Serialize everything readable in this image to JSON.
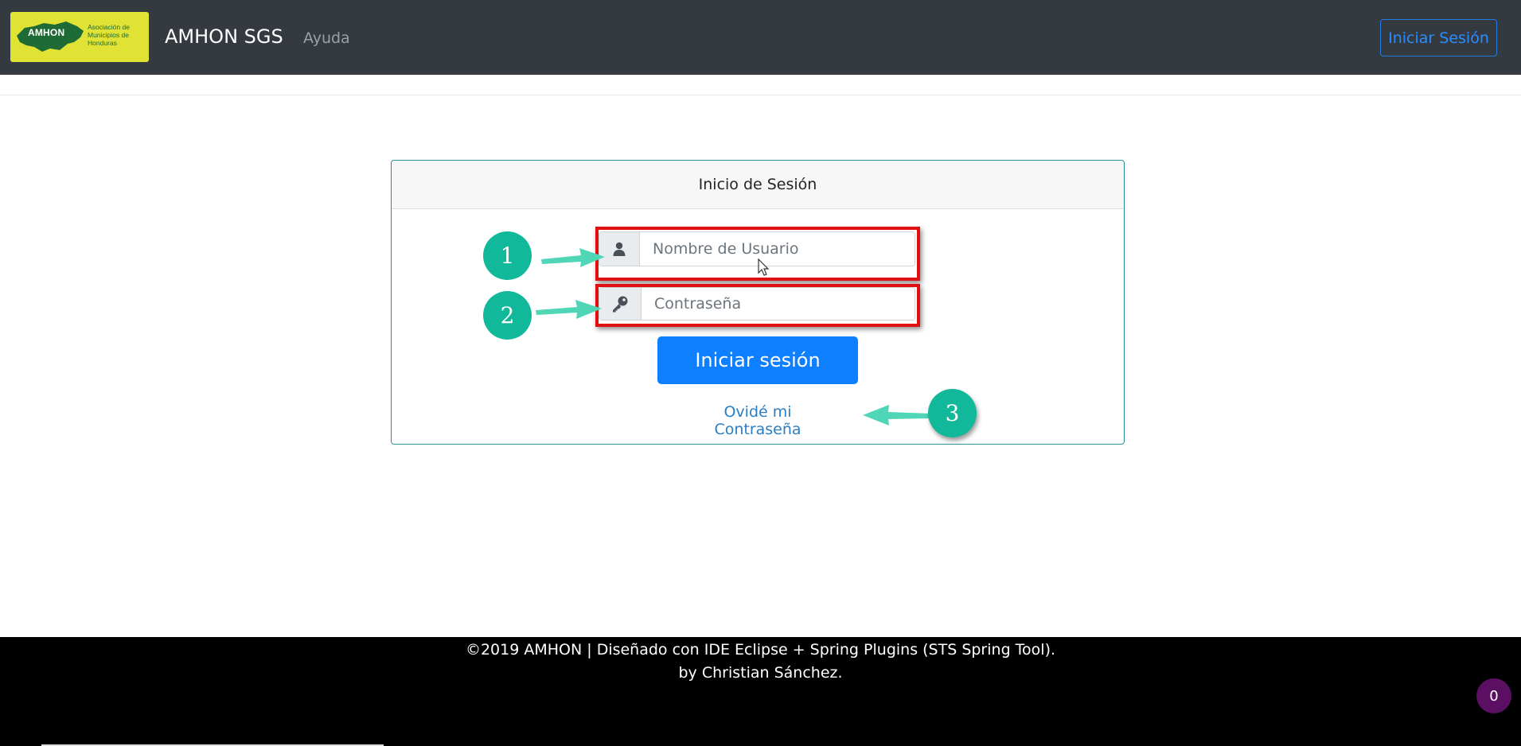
{
  "logo": {
    "mark": "AMHON",
    "sub": "Asociación de Municipios de Honduras"
  },
  "navbar": {
    "brand": "AMHON SGS",
    "help_link": "Ayuda",
    "login_button": "Iniciar Sesión"
  },
  "login_card": {
    "title": "Inicio de Sesión",
    "username": {
      "placeholder": "Nombre de Usuario",
      "value": "",
      "icon": "user-icon"
    },
    "password": {
      "placeholder": "Contraseña",
      "value": "",
      "icon": "key-icon"
    },
    "submit_label": "Iniciar sesión",
    "forgot_link": "Ovidé mi Contraseña"
  },
  "annotations": {
    "step1": "1",
    "step2": "2",
    "step3": "3"
  },
  "footer": {
    "line1": "©2019 AMHON | Diseñado con IDE Eclipse + Spring Plugins (STS Spring Tool).",
    "line2": "by Christian Sánchez.",
    "counter": "0"
  },
  "colors": {
    "navbar": "#343a40",
    "primary": "#0d7fff",
    "annotation": "#12b89a",
    "highlight": "#e01010",
    "footer": "#000000"
  }
}
